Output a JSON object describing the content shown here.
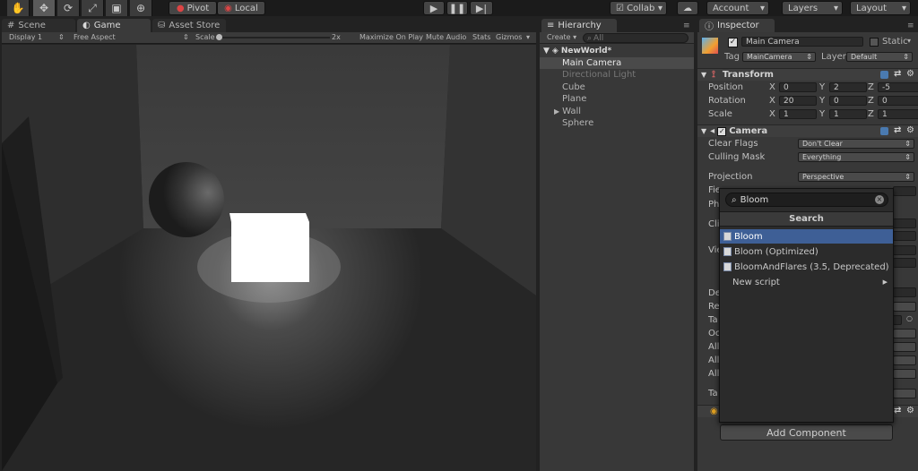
{
  "toolbar": {
    "pivot": "Pivot",
    "local": "Local",
    "collab": "Collab",
    "account": "Account",
    "layers": "Layers",
    "layout": "Layout"
  },
  "tabs": {
    "scene": "Scene",
    "game": "Game",
    "asset_store": "Asset Store",
    "hierarchy": "Hierarchy",
    "inspector": "Inspector"
  },
  "game_bar": {
    "display": "Display 1",
    "aspect": "Free Aspect",
    "scale_label": "Scale",
    "scale_value": "2x",
    "maximize": "Maximize On Play",
    "mute": "Mute Audio",
    "stats": "Stats",
    "gizmos": "Gizmos"
  },
  "hierarchy": {
    "create": "Create",
    "search_placeholder": "All",
    "scene_name": "NewWorld*",
    "items": [
      "Main Camera",
      "Directional Light",
      "Cube",
      "Plane",
      "Wall",
      "Sphere"
    ]
  },
  "inspector": {
    "object_name": "Main Camera",
    "static_label": "Static",
    "tag_label": "Tag",
    "tag_value": "MainCamera",
    "layer_label": "Layer",
    "layer_value": "Default",
    "transform": {
      "title": "Transform",
      "rows": [
        {
          "label": "Position",
          "x": "0",
          "y": "2",
          "z": "-5"
        },
        {
          "label": "Rotation",
          "x": "20",
          "y": "0",
          "z": "0"
        },
        {
          "label": "Scale",
          "x": "1",
          "y": "1",
          "z": "1"
        }
      ]
    },
    "camera": {
      "title": "Camera",
      "clear_flags_label": "Clear Flags",
      "clear_flags_value": "Don't Clear",
      "culling_mask_label": "Culling Mask",
      "culling_mask_value": "Everything",
      "projection_label": "Projection",
      "projection_value": "Perspective",
      "partial_labels": [
        "Fie",
        "Ph",
        "Cli",
        "Vie",
        "De",
        "Re",
        "Ta",
        "Oc",
        "All",
        "All",
        "All",
        "Ta"
      ]
    },
    "add_component": "Add Component"
  },
  "popup": {
    "search_value": "Bloom",
    "header": "Search",
    "items": [
      "Bloom",
      "Bloom (Optimized)",
      "BloomAndFlares (3.5, Deprecated)"
    ],
    "new_script": "New script"
  },
  "colors": {
    "selection": "#3e5f96",
    "panel": "#383838"
  }
}
